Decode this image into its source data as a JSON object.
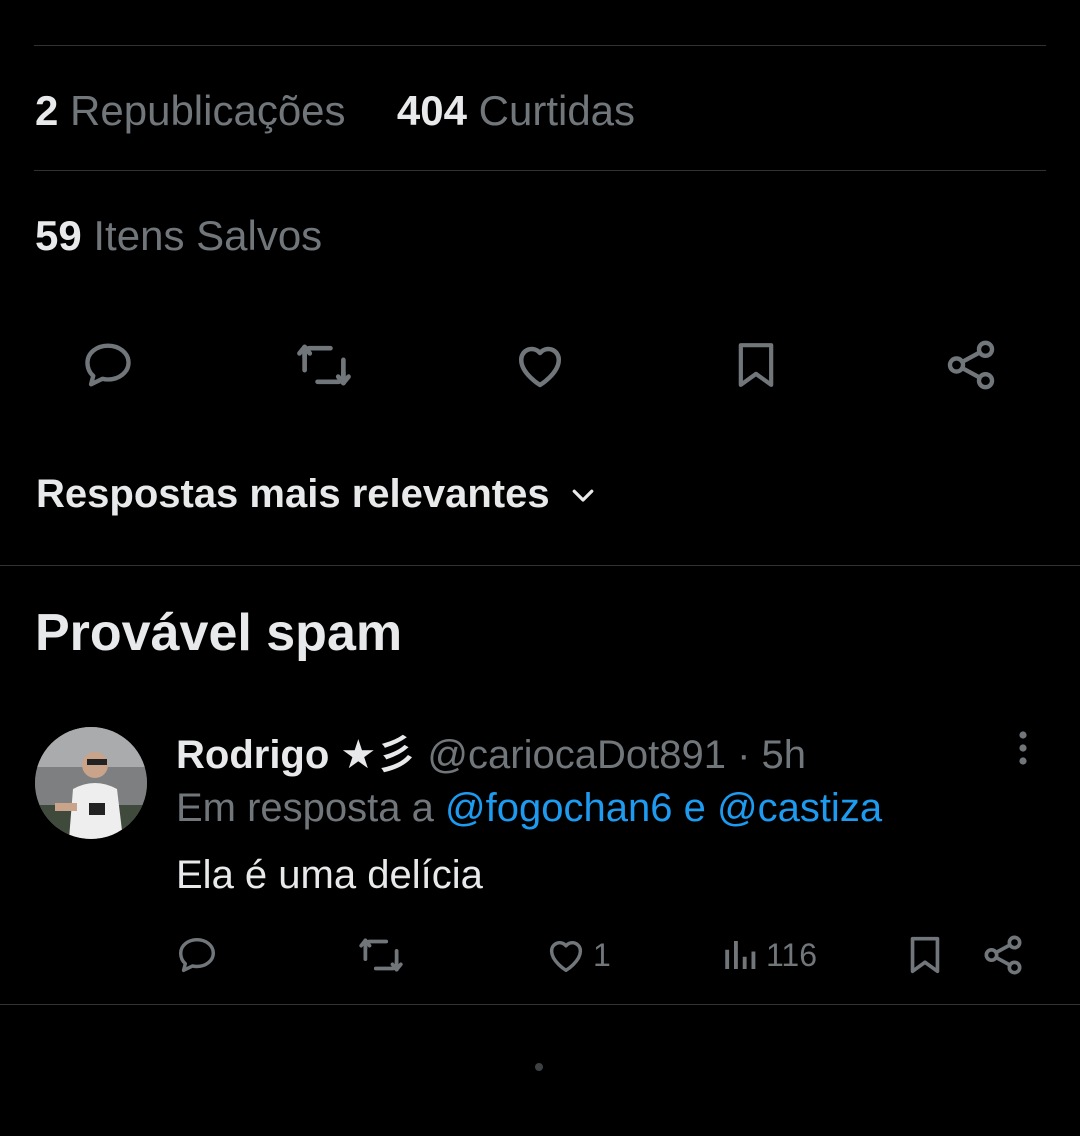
{
  "stats": {
    "reposts_count": "2",
    "reposts_label": "Republicações",
    "likes_count": "404",
    "likes_label": "Curtidas",
    "bookmarks_count": "59",
    "bookmarks_label": "Itens Salvos"
  },
  "actions": [
    "reply-icon",
    "repost-icon",
    "like-icon",
    "bookmark-icon",
    "share-icon"
  ],
  "sort": {
    "label": "Respostas mais relevantes"
  },
  "section": {
    "title": "Provável spam"
  },
  "reply": {
    "name": "Rodrigo ★彡",
    "handle": "@cariocaDot891",
    "separator": "·",
    "time": "5h",
    "replying_prefix": "Em resposta a",
    "mention_1": "@fogochan6",
    "conjunction": "e",
    "mention_2": "@castiza",
    "text": "Ela é uma delícia",
    "like_count": "1",
    "view_count": "116"
  },
  "colors": {
    "background": "#000000",
    "primary_text": "#e7e9ea",
    "secondary_text": "#71767b",
    "link": "#1d9bf0",
    "divider": "#2f3336"
  }
}
